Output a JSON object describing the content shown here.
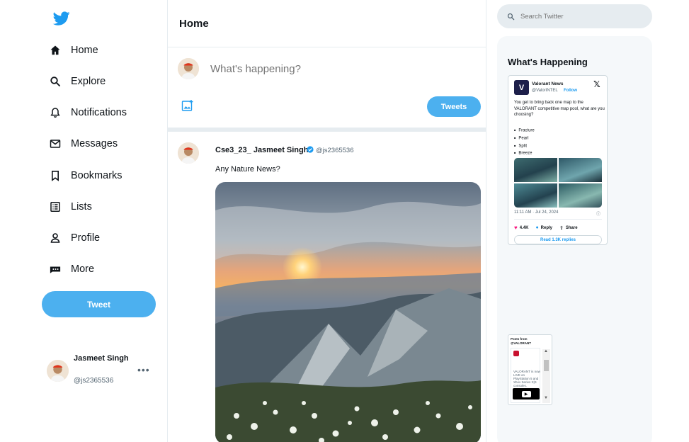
{
  "sidebar": {
    "nav": [
      {
        "label": "Home",
        "icon": "home-icon"
      },
      {
        "label": "Explore",
        "icon": "search-icon"
      },
      {
        "label": "Notifications",
        "icon": "bell-icon"
      },
      {
        "label": "Messages",
        "icon": "envelope-icon"
      },
      {
        "label": "Bookmarks",
        "icon": "bookmark-icon"
      },
      {
        "label": "Lists",
        "icon": "list-icon"
      },
      {
        "label": "Profile",
        "icon": "person-icon"
      },
      {
        "label": "More",
        "icon": "more-icon"
      }
    ],
    "tweet_label": "Tweet",
    "account": {
      "name": "Jasmeet Singh",
      "handle": "@js2365536",
      "menu": "•••"
    }
  },
  "feed": {
    "title": "Home",
    "compose": {
      "placeholder": "What's happening?",
      "send_label": "Tweets"
    },
    "post": {
      "name": "Cse3_23_ Jasmeet Singh",
      "handle": "@js2365536",
      "text": "Any Nature News?"
    }
  },
  "right": {
    "search_placeholder": "Search Twitter",
    "heading": "What's Happening",
    "embed": {
      "avatar_letter": "V",
      "name": "Valorant News",
      "handle": "@ValorINTEL",
      "follow": "Follow",
      "x": "𝕏",
      "body": "You get to bring back one map to the VALORANT competitive map pool, what are you choosing?",
      "maps": [
        "Fracture",
        "Pearl",
        "Split",
        "Breeze"
      ],
      "time": "11:11 AM · Jul 24, 2024",
      "likes": "4.4K",
      "reply": "Reply",
      "share": "Share",
      "read_replies": "Read 1.3K replies"
    },
    "mini": {
      "title_line1": "Posts from",
      "title_line2": "@VALORANT",
      "text": "VALORANT is now LIVE on PlayStation 5 and Xbox Series X|S consoles."
    }
  },
  "colors": {
    "accent": "#4cb0ef",
    "brand": "#1d9bf0",
    "panel": "#f5f8fa"
  }
}
